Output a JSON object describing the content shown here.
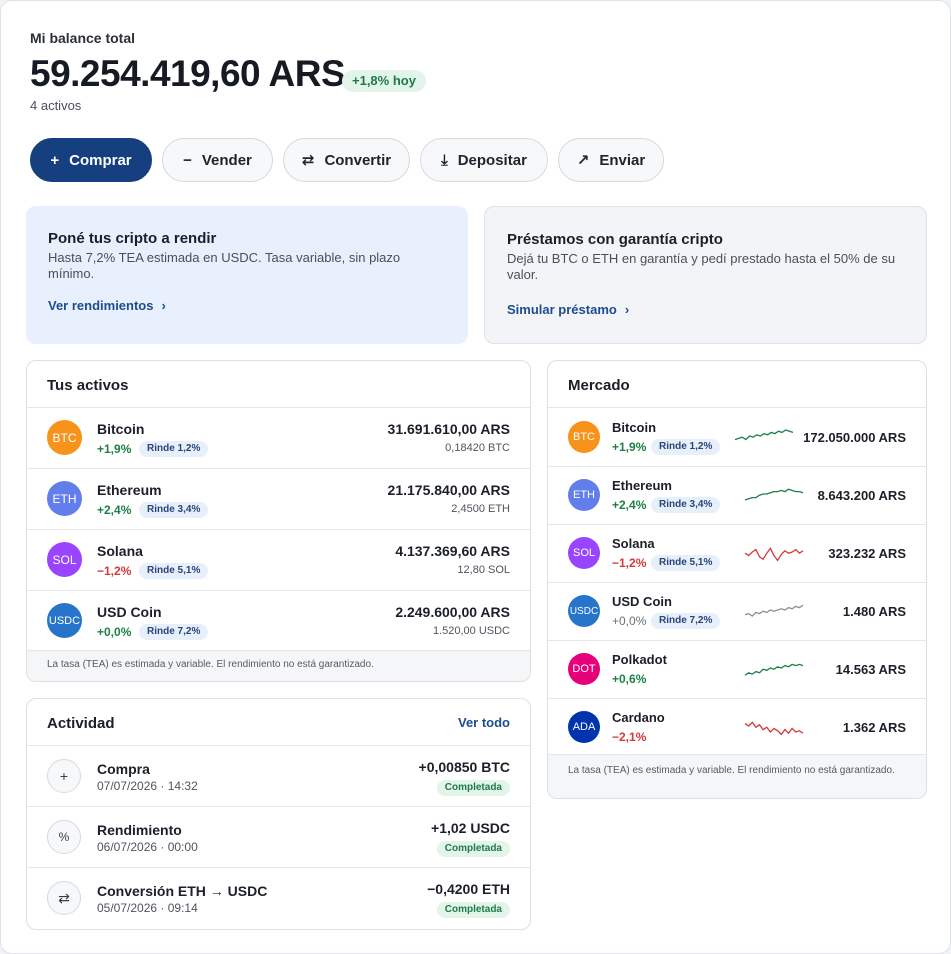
{
  "balance": {
    "label": "Mi balance total",
    "value": "59.254.419,60 ARS",
    "today": "+1,8% hoy",
    "assets_count": "4 activos"
  },
  "actions": [
    {
      "label": "Comprar",
      "icon": "plus-icon",
      "glyph": "+"
    },
    {
      "label": "Vender",
      "icon": "minus-icon",
      "glyph": "−"
    },
    {
      "label": "Convertir",
      "icon": "swap-arrows-icon",
      "glyph": "⇄"
    },
    {
      "label": "Depositar",
      "icon": "download-icon",
      "glyph": "⤓"
    },
    {
      "label": "Enviar",
      "icon": "arrow-up-right-icon",
      "glyph": "↗"
    }
  ],
  "promos": [
    {
      "title": "Poné tus cripto a rendir",
      "desc": "Hasta 7,2% TEA estimada en USDC. Tasa variable, sin plazo mínimo.",
      "link": "Ver rendimientos"
    },
    {
      "title": "Préstamos con garantía cripto",
      "desc": "Dejá tu BTC o ETH en garantía y pedí prestado hasta el 50% de su valor.",
      "link": "Simular préstamo"
    }
  ],
  "holdings": {
    "title": "Tus activos",
    "rows": [
      {
        "symbol": "BTC",
        "name": "Bitcoin",
        "change": "+1,9%",
        "trend": "up",
        "yield": "Rinde 1,2%",
        "value": "31.691.610,00 ARS",
        "qty": "0,18420 BTC",
        "color": "#f7931a"
      },
      {
        "symbol": "ETH",
        "name": "Ethereum",
        "change": "+2,4%",
        "trend": "up",
        "yield": "Rinde 3,4%",
        "value": "21.175.840,00 ARS",
        "qty": "2,4500 ETH",
        "color": "#627eea"
      },
      {
        "symbol": "SOL",
        "name": "Solana",
        "change": "−1,2%",
        "trend": "down",
        "yield": "Rinde 5,1%",
        "value": "4.137.369,60 ARS",
        "qty": "12,80 SOL",
        "color": "#9945ff"
      },
      {
        "symbol": "USDC",
        "name": "USD Coin",
        "change": "+0,0%",
        "trend": "up",
        "yield": "Rinde 7,2%",
        "value": "2.249.600,00 ARS",
        "qty": "1.520,00 USDC",
        "color": "#2775ca"
      }
    ],
    "footnote": "La tasa (TEA) es estimada y variable. El rendimiento no está garantizado."
  },
  "activity": {
    "title": "Actividad",
    "see_all": "Ver todo",
    "rows": [
      {
        "icon": "plus-icon",
        "glyph": "+",
        "title": "Compra",
        "date": "07/07/2026 · 14:32",
        "amount": "+0,00850 BTC",
        "trend": "up",
        "status": "Completada"
      },
      {
        "icon": "percent-icon",
        "glyph": "%",
        "title": "Rendimiento",
        "date": "06/07/2026 · 00:00",
        "amount": "+1,02 USDC",
        "trend": "up",
        "status": "Completada"
      },
      {
        "icon": "swap-arrows-icon",
        "glyph": "⇄",
        "title": "Conversión ETH → USDC",
        "date": "05/07/2026 · 09:14",
        "amount": "−0,4200 ETH",
        "trend": "neutral",
        "status": "Completada"
      }
    ]
  },
  "market": {
    "title": "Mercado",
    "rows": [
      {
        "symbol": "BTC",
        "name": "Bitcoin",
        "change": "+1,9%",
        "trend": "up",
        "yield": "Rinde 1,2%",
        "price": "172.050.000 ARS",
        "color": "#f7931a",
        "spark_color": "#1d8046"
      },
      {
        "symbol": "ETH",
        "name": "Ethereum",
        "change": "+2,4%",
        "trend": "up",
        "yield": "Rinde 3,4%",
        "price": "8.643.200 ARS",
        "color": "#627eea",
        "spark_color": "#1d8046"
      },
      {
        "symbol": "SOL",
        "name": "Solana",
        "change": "−1,2%",
        "trend": "down",
        "yield": "Rinde 5,1%",
        "price": "323.232 ARS",
        "color": "#9945ff",
        "spark_color": "#d23a3a"
      },
      {
        "symbol": "USDC",
        "name": "USD Coin",
        "change": "+0,0%",
        "trend": "flat",
        "yield": "Rinde 7,2%",
        "price": "1.480 ARS",
        "color": "#2775ca",
        "spark_color": "#8b9099"
      },
      {
        "symbol": "DOT",
        "name": "Polkadot",
        "change": "+0,6%",
        "trend": "up",
        "yield": "",
        "price": "14.563 ARS",
        "color": "#e6007a",
        "spark_color": "#1d8046"
      },
      {
        "symbol": "ADA",
        "name": "Cardano",
        "change": "−2,1%",
        "trend": "down",
        "yield": "",
        "price": "1.362 ARS",
        "color": "#0033ad",
        "spark_color": "#d23a3a"
      }
    ],
    "footnote": "La tasa (TEA) es estimada y variable. El rendimiento no está garantizado."
  }
}
